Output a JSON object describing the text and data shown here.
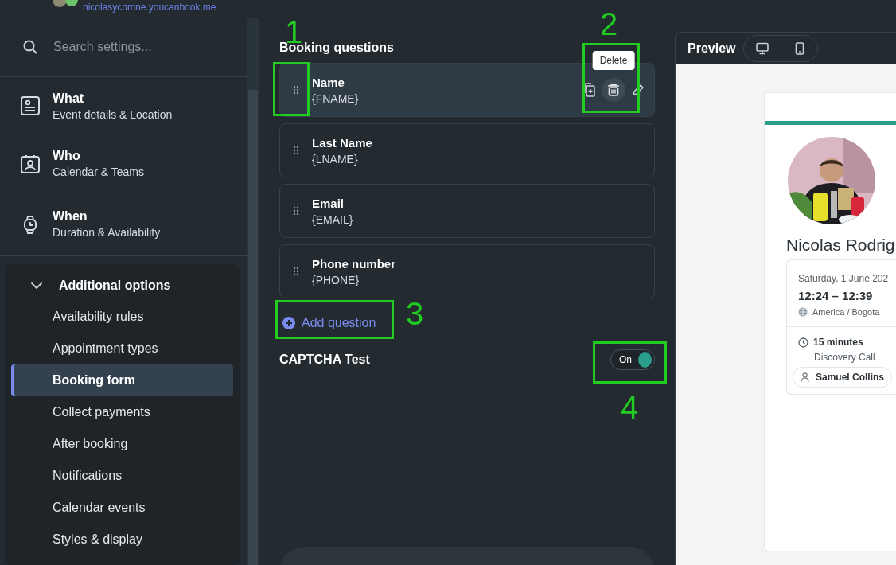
{
  "account": {
    "url": "nicolasycbmne.youcanbook.me"
  },
  "search": {
    "placeholder": "Search settings..."
  },
  "sections": [
    {
      "title": "What",
      "subtitle": "Event details & Location"
    },
    {
      "title": "Who",
      "subtitle": "Calendar & Teams"
    },
    {
      "title": "When",
      "subtitle": "Duration & Availability"
    }
  ],
  "additional_options": {
    "title": "Additional options",
    "expanded": true,
    "items": [
      {
        "label": "Availability rules",
        "selected": false
      },
      {
        "label": "Appointment types",
        "selected": false
      },
      {
        "label": "Booking form",
        "selected": true
      },
      {
        "label": "Collect payments",
        "selected": false
      },
      {
        "label": "After booking",
        "selected": false
      },
      {
        "label": "Notifications",
        "selected": false
      },
      {
        "label": "Calendar events",
        "selected": false
      },
      {
        "label": "Styles & display",
        "selected": false
      }
    ]
  },
  "booking_questions": {
    "title": "Booking questions",
    "questions": [
      {
        "label": "Name",
        "token": "{FNAME}",
        "hovered": true
      },
      {
        "label": "Last Name",
        "token": "{LNAME}",
        "hovered": false
      },
      {
        "label": "Email",
        "token": "{EMAIL}",
        "hovered": false
      },
      {
        "label": "Phone number",
        "token": "{PHONE}",
        "hovered": false
      }
    ]
  },
  "tooltip": "Delete",
  "add_question": "Add question",
  "captcha": {
    "label": "CAPTCHA Test",
    "toggle_text": "On",
    "on": true
  },
  "preview": {
    "title": "Preview",
    "name": "Nicolas Rodrig",
    "date": "Saturday, 1 June 202",
    "time": "12:24 – 12:39",
    "timezone": "America / Bogota",
    "duration": "15 minutes",
    "type": "Discovery Call",
    "host": "Samuel Collins"
  },
  "annotations": [
    "1",
    "2",
    "3",
    "4"
  ]
}
